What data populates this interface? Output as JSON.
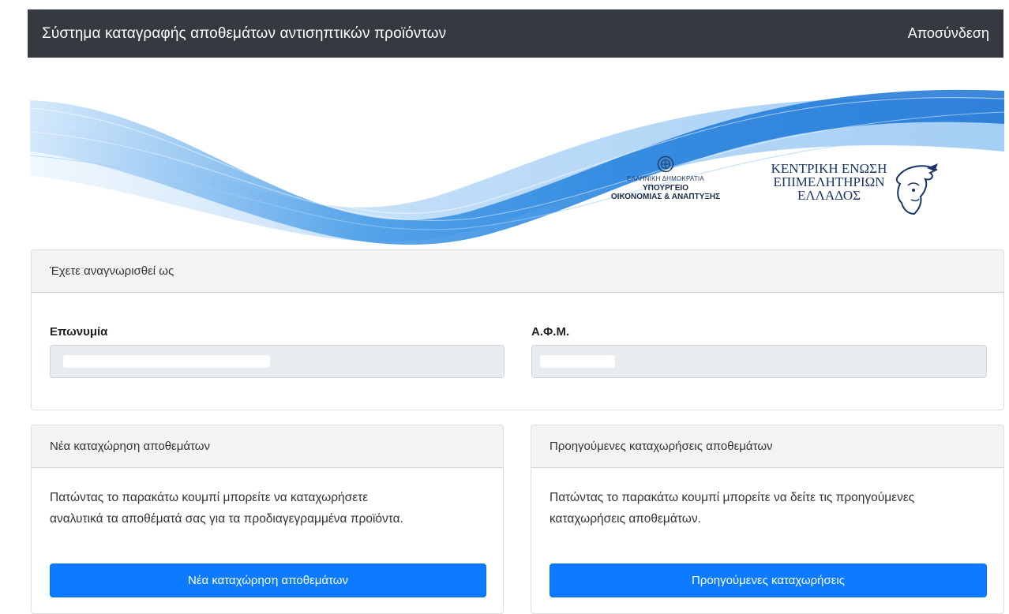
{
  "navbar": {
    "title": "Σύστημα καταγραφής αποθεμάτων αντισηπτικών προϊόντων",
    "logout_label": "Αποσύνδεση"
  },
  "banner": {
    "ministry": {
      "line1": "ΕΛΛΗΝΙΚΗ ΔΗΜΟΚΡΑΤΙΑ",
      "line2": "ΥΠΟΥΡΓΕΙΟ",
      "line3": "ΟΙΚΟΝΟΜΙΑΣ & ΑΝΑΠΤΥΞΗΣ"
    },
    "chamber": {
      "line1": "ΚΕΝΤΡΙΚΗ ΕΝΩΣΗ",
      "line2": "ΕΠΙΜΕΛΗΤΗΡΙΩΝ",
      "line3": "ΕΛΛΑΔΟΣ"
    }
  },
  "identity": {
    "header": "Έχετε αναγνωρισθεί ως",
    "name_label": "Επωνυμία",
    "name_value": "",
    "afm_label": "Α.Φ.Μ.",
    "afm_value": ""
  },
  "new_entry": {
    "header": "Νέα καταχώρηση αποθεμάτων",
    "text_line1": "Πατώντας το παρακάτω κουμπί μπορείτε να καταχωρήσετε",
    "text_line2": "αναλυτικά τα αποθέματά σας για τα προδιαγεγραμμένα προϊόντα.",
    "button_label": "Νέα καταχώρηση αποθεμάτων"
  },
  "previous_entries": {
    "header": "Προηγούμενες καταχωρήσεις αποθεμάτων",
    "text_line1": "Πατώντας το παρακάτω κουμπί μπορείτε να δείτε τις προηγούμενες",
    "text_line2": "καταχωρήσεις αποθεμάτων.",
    "button_label": "Προηγούμενες καταχωρήσεις"
  },
  "colors": {
    "navbar_bg": "#343a40",
    "primary": "#0d7bff",
    "card_header_bg": "#f2f3f5",
    "field_bg": "#e9ecef"
  }
}
